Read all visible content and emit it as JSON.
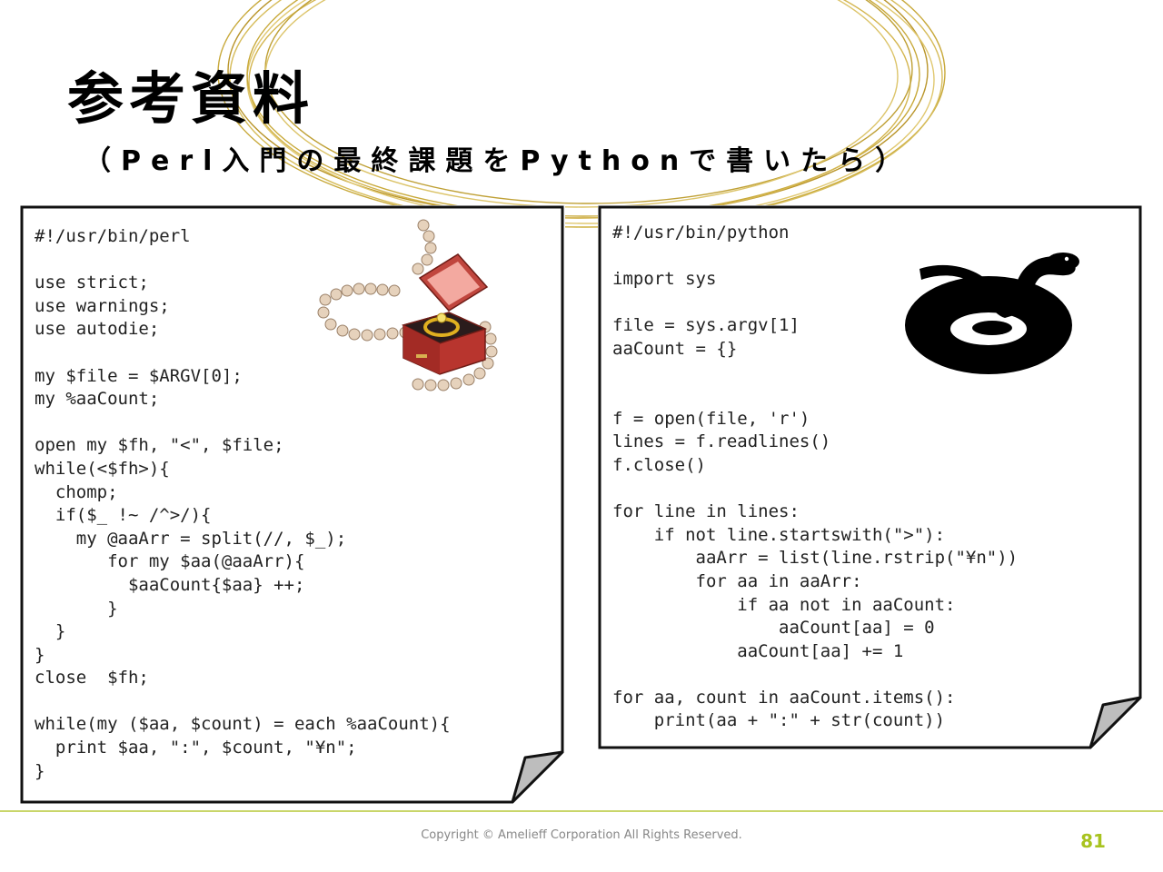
{
  "slide": {
    "title": "参考資料",
    "subtitle": "（Perl入門の最終課題をPythonで書いたら）"
  },
  "perl_code": "#!/usr/bin/perl\n\nuse strict;\nuse warnings;\nuse autodie;\n\nmy $file = $ARGV[0];\nmy %aaCount;\n\nopen my $fh, \"<\", $file;\nwhile(<$fh>){\n  chomp;\n  if($_ !~ /^>/){\n    my @aaArr = split(//, $_);\n       for my $aa(@aaArr){\n         $aaCount{$aa} ++;\n       }\n  }\n}\nclose  $fh;\n\nwhile(my ($aa, $count) = each %aaCount){\n  print $aa, \":\", $count, \"¥n\";\n}",
  "python_code": "#!/usr/bin/python\n\nimport sys\n\nfile = sys.argv[1]\naaCount = {}\n\n\nf = open(file, 'r')\nlines = f.readlines()\nf.close()\n\nfor line in lines:\n    if not line.startswith(\">\"):\n        aaArr = list(line.rstrip(\"¥n\"))\n        for aa in aaArr:\n            if aa not in aaCount:\n                aaCount[aa] = 0\n            aaCount[aa] += 1\n\nfor aa, count in aaCount.items():\n    print(aa + \":\" + str(count))",
  "illustrations": {
    "perl": "pearl-necklace-ring-box-icon",
    "python": "coiled-snake-icon"
  },
  "footer": {
    "copyright": "Copyright © Amelieff Corporation All Rights Reserved.",
    "page_number": "81"
  },
  "colors": {
    "accent": "#a8c31f",
    "deco_gold": "#c8a93a"
  }
}
